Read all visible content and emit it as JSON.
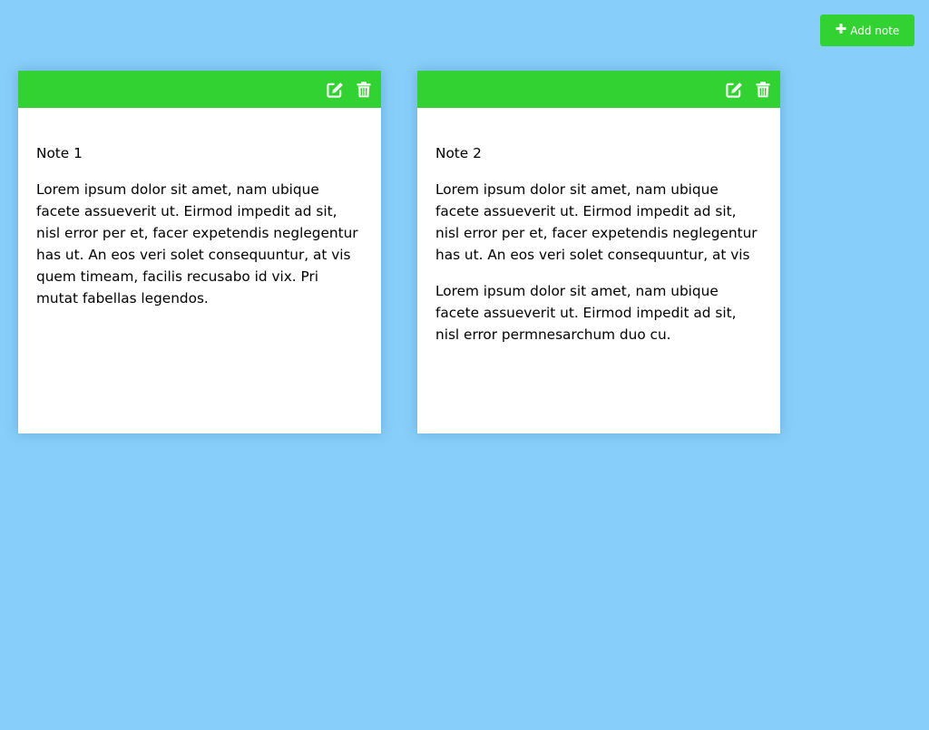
{
  "colors": {
    "background": "#87cefa",
    "accent": "#32d233",
    "card": "#ffffff"
  },
  "header": {
    "add_button_icon": "plus-icon",
    "add_button_label": "Add note"
  },
  "notes": [
    {
      "title": "Note 1",
      "paragraphs": [
        "Lorem ipsum dolor sit amet, nam ubique facete assueverit ut. Eirmod impedit ad sit, nisl error per et, facer expetendis neglegentur has ut. An eos veri solet consequuntur, at vis quem timeam, facilis recusabo id vix. Pri mutat fabellas legendos."
      ],
      "icons": [
        "edit-icon",
        "trash-icon"
      ]
    },
    {
      "title": "Note 2",
      "paragraphs": [
        "Lorem ipsum dolor sit amet, nam ubique facete assueverit ut. Eirmod impedit ad sit, nisl error per et, facer expetendis neglegentur has ut. An eos veri solet consequuntur, at vis",
        "Lorem ipsum dolor sit amet, nam ubique facete assueverit ut. Eirmod impedit ad sit, nisl error permnesarchum duo cu."
      ],
      "icons": [
        "edit-icon",
        "trash-icon"
      ]
    }
  ]
}
